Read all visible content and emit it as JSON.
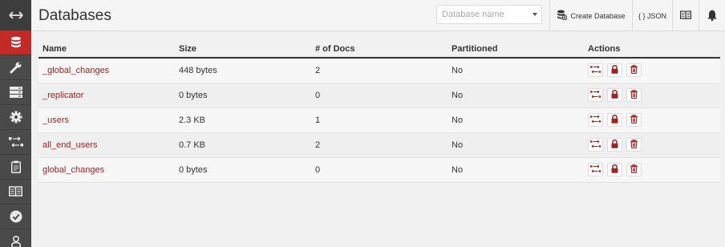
{
  "sidebar": {
    "items": [
      {
        "icon": "toggle-arrows-icon",
        "label": "Toggle menu"
      },
      {
        "icon": "database-icon",
        "label": "Databases",
        "active": true
      },
      {
        "icon": "wrench-icon",
        "label": "Setup"
      },
      {
        "icon": "server-icon",
        "label": "Active Tasks"
      },
      {
        "icon": "gear-icon",
        "label": "Configuration"
      },
      {
        "icon": "replication-icon",
        "label": "Replication"
      },
      {
        "icon": "clipboard-icon",
        "label": "Clipboard"
      },
      {
        "icon": "book-icon",
        "label": "Documentation"
      },
      {
        "icon": "check-circle-icon",
        "label": "Verify"
      },
      {
        "icon": "user-icon",
        "label": "User"
      }
    ]
  },
  "header": {
    "title": "Databases",
    "search_placeholder": "Database name",
    "create_label": "Create Database",
    "json_label": "{ } JSON"
  },
  "table": {
    "columns": [
      "Name",
      "Size",
      "# of Docs",
      "Partitioned",
      "Actions"
    ],
    "rows": [
      {
        "name": "_global_changes",
        "size": "448 bytes",
        "docs": "2",
        "partitioned": "No"
      },
      {
        "name": "_replicator",
        "size": "0 bytes",
        "docs": "0",
        "partitioned": "No"
      },
      {
        "name": "_users",
        "size": "2.3 KB",
        "docs": "1",
        "partitioned": "No"
      },
      {
        "name": "all_end_users",
        "size": "0.7 KB",
        "docs": "2",
        "partitioned": "No"
      },
      {
        "name": "global_changes",
        "size": "0 bytes",
        "docs": "0",
        "partitioned": "No"
      }
    ]
  },
  "colors": {
    "accent": "#c32a26",
    "sidebar": "#4a4a4a",
    "link": "#a32222"
  }
}
